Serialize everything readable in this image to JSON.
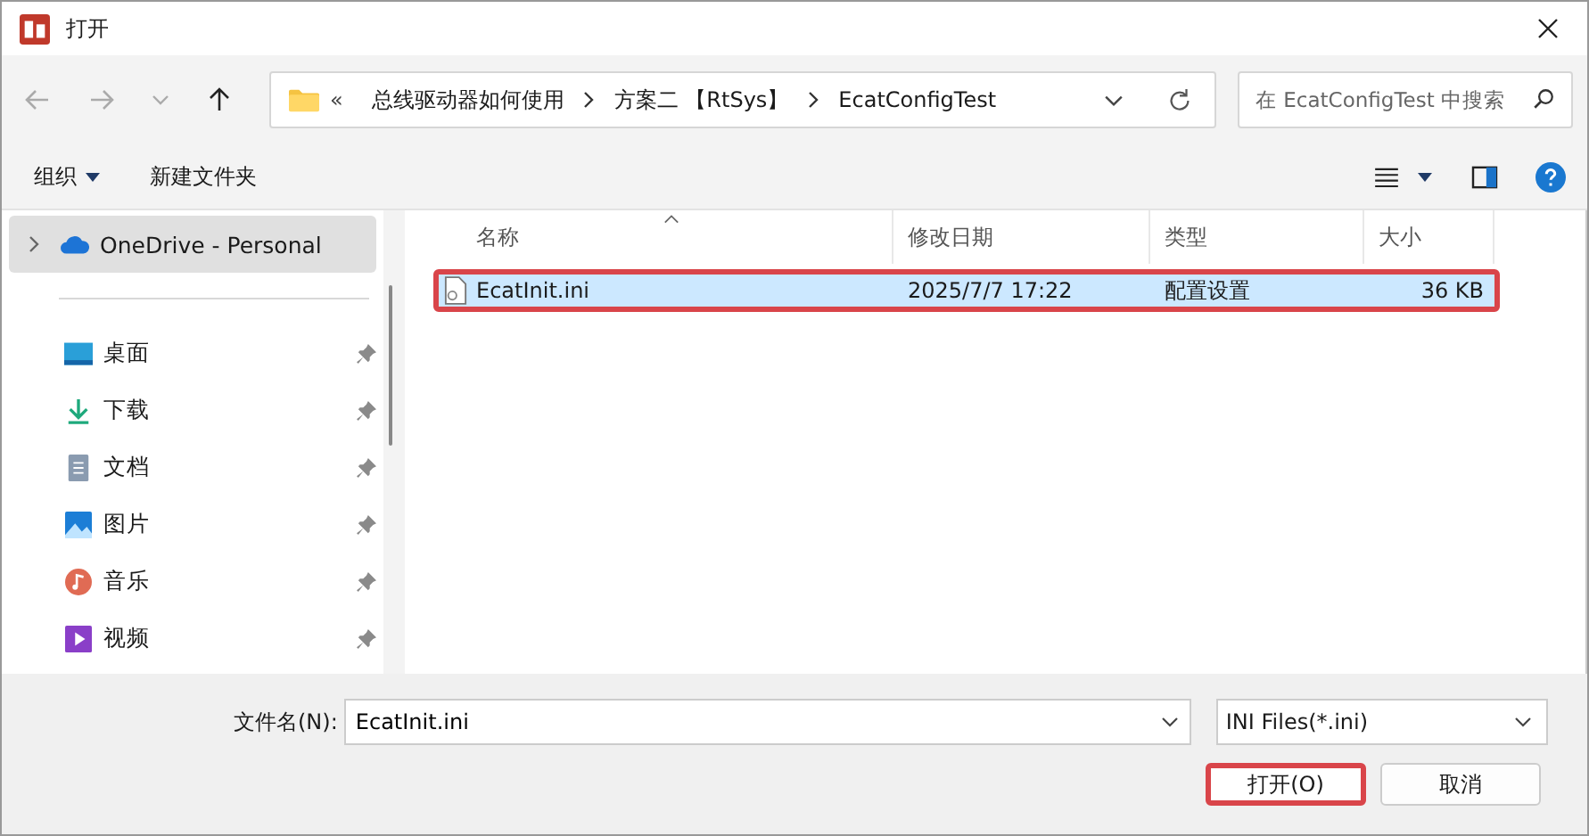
{
  "window": {
    "title": "打开"
  },
  "nav": {
    "back_disabled": true,
    "forward_disabled": true,
    "up_disabled": false
  },
  "address": {
    "overflow": "«",
    "segments": [
      "总线驱动器如何使用",
      "方案二 【RtSys】",
      "EcatConfigTest"
    ]
  },
  "search": {
    "placeholder": "在 EcatConfigTest 中搜索"
  },
  "toolbar": {
    "organize": "组织",
    "new_folder": "新建文件夹"
  },
  "sidebar": {
    "items": [
      {
        "label": "OneDrive - Personal",
        "kind": "cloud",
        "selected": true,
        "pinned": false,
        "expandable": true
      },
      {
        "label": "桌面",
        "kind": "desktop",
        "selected": false,
        "pinned": true,
        "expandable": false
      },
      {
        "label": "下载",
        "kind": "download",
        "selected": false,
        "pinned": true,
        "expandable": false
      },
      {
        "label": "文档",
        "kind": "documents",
        "selected": false,
        "pinned": true,
        "expandable": false
      },
      {
        "label": "图片",
        "kind": "pictures",
        "selected": false,
        "pinned": true,
        "expandable": false
      },
      {
        "label": "音乐",
        "kind": "music",
        "selected": false,
        "pinned": true,
        "expandable": false
      },
      {
        "label": "视频",
        "kind": "videos",
        "selected": false,
        "pinned": true,
        "expandable": false
      }
    ]
  },
  "table": {
    "columns": [
      "名称",
      "修改日期",
      "类型",
      "大小"
    ],
    "rows": [
      {
        "name": "EcatInit.ini",
        "modified": "2025/7/7 17:22",
        "type": "配置设置",
        "size": "36 KB",
        "selected": true,
        "annotated": true
      }
    ]
  },
  "footer": {
    "filename_label": "文件名(N):",
    "filename": "EcatInit.ini",
    "filter": "INI Files(*.ini)",
    "buttons": [
      {
        "label": "打开(O)",
        "annotated": true
      },
      {
        "label": "取消",
        "annotated": false
      }
    ]
  }
}
